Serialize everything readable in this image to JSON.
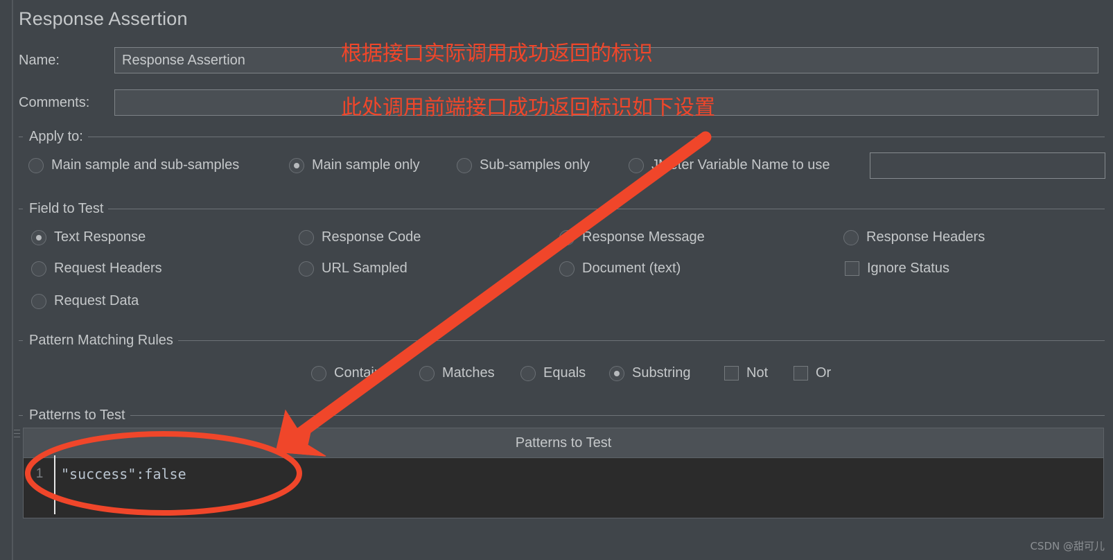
{
  "window": {
    "title": "Response Assertion"
  },
  "form": {
    "name_label": "Name:",
    "name_value": "Response Assertion",
    "name_placeholder": "",
    "comments_label": "Comments:",
    "comments_value": "",
    "comments_placeholder": ""
  },
  "apply_to": {
    "legend": "Apply to:",
    "options": [
      {
        "label": "Main sample and sub-samples",
        "selected": false
      },
      {
        "label": "Main sample only",
        "selected": true
      },
      {
        "label": "Sub-samples only",
        "selected": false
      },
      {
        "label": "JMeter Variable Name to use",
        "selected": false
      }
    ],
    "variable_value": "",
    "variable_placeholder": ""
  },
  "field_to_test": {
    "legend": "Field to Test",
    "options": [
      {
        "label": "Text Response",
        "type": "radio",
        "selected": true
      },
      {
        "label": "Response Code",
        "type": "radio",
        "selected": false
      },
      {
        "label": "Response Message",
        "type": "radio",
        "selected": false
      },
      {
        "label": "Response Headers",
        "type": "radio",
        "selected": false
      },
      {
        "label": "Request Headers",
        "type": "radio",
        "selected": false
      },
      {
        "label": "URL Sampled",
        "type": "radio",
        "selected": false
      },
      {
        "label": "Document (text)",
        "type": "radio",
        "selected": false
      },
      {
        "label": "Ignore Status",
        "type": "checkbox",
        "selected": false
      },
      {
        "label": "Request Data",
        "type": "radio",
        "selected": false
      }
    ]
  },
  "pattern_matching_rules": {
    "legend": "Pattern Matching Rules",
    "options": [
      {
        "label": "Contains",
        "type": "radio",
        "selected": false
      },
      {
        "label": "Matches",
        "type": "radio",
        "selected": false
      },
      {
        "label": "Equals",
        "type": "radio",
        "selected": false
      },
      {
        "label": "Substring",
        "type": "radio",
        "selected": true
      },
      {
        "label": "Not",
        "type": "checkbox",
        "selected": false
      },
      {
        "label": "Or",
        "type": "checkbox",
        "selected": false
      }
    ]
  },
  "patterns_to_test": {
    "legend": "Patterns to Test",
    "column_header": "Patterns to Test",
    "rows": [
      {
        "number": "1",
        "pattern": "\"success\":false"
      }
    ]
  },
  "annotations": {
    "note_top": "根据接口实际调用成功返回的标识",
    "note_bottom": "此处调用前端接口成功返回标识如下设置",
    "color": "#f0462a"
  },
  "watermark": {
    "text": "CSDN @甜可儿"
  }
}
